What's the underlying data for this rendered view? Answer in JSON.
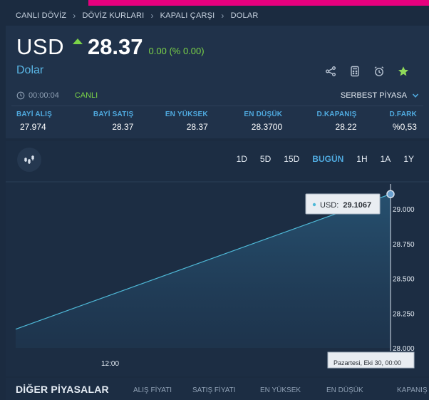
{
  "breadcrumb": [
    "CANLI DÖVİZ",
    "DÖVİZ KURLARI",
    "KAPALI ÇARŞI",
    "DOLAR"
  ],
  "header": {
    "symbol": "USD",
    "price": "28.37",
    "change": "0.00 (% 0.00)",
    "name": "Dolar",
    "trend": "up"
  },
  "status": {
    "time": "00:00:04",
    "live_label": "CANLI",
    "market": "SERBEST PİYASA"
  },
  "stats": [
    {
      "label": "BAYİ ALIŞ",
      "value": "27.974"
    },
    {
      "label": "BAYİ SATIŞ",
      "value": "28.37"
    },
    {
      "label": "EN YÜKSEK",
      "value": "28.37"
    },
    {
      "label": "EN DÜŞÜK",
      "value": "28.3700"
    },
    {
      "label": "D.KAPANIŞ",
      "value": "28.22"
    },
    {
      "label": "D.FARK",
      "value": "%0,53"
    }
  ],
  "ranges": [
    {
      "label": "1D",
      "active": false
    },
    {
      "label": "5D",
      "active": false
    },
    {
      "label": "15D",
      "active": false
    },
    {
      "label": "BUGÜN",
      "active": true
    },
    {
      "label": "1H",
      "active": false
    },
    {
      "label": "1A",
      "active": false
    },
    {
      "label": "1Y",
      "active": false
    }
  ],
  "icons": {
    "share": "share-icon",
    "calculator": "calculator-icon",
    "alarm": "alarm-clock-icon",
    "favorite": "star-icon",
    "clock": "clock-icon",
    "candles": "candlestick-icon",
    "dropdown": "chevron-down-icon"
  },
  "colors": {
    "accent_bar": "#e6007e",
    "up": "#7bd348",
    "link": "#4fa9de",
    "line": "#4fb9d8"
  },
  "chart_data": {
    "type": "area",
    "series": [
      {
        "name": "USD",
        "x": [
          "start",
          "Pazartesi, Eki 30, 00:00"
        ],
        "values": [
          28.135,
          29.1067
        ]
      }
    ],
    "ylim": [
      28.0,
      29.2
    ],
    "yticks": [
      "29.000",
      "28.750",
      "28.500",
      "28.250",
      "28.000"
    ],
    "xticks": [
      "12:00"
    ],
    "tooltip": {
      "label": "USD:",
      "value": "29.1067"
    },
    "crosshair_label": "Pazartesi, Eki 30, 00:00",
    "grid": false
  },
  "bottom": {
    "title": "DİĞER PİYASALAR",
    "columns": [
      "ALIŞ FİYATI",
      "SATIŞ FİYATI",
      "EN YÜKSEK",
      "EN DÜŞÜK",
      "KAPANIŞ"
    ]
  }
}
